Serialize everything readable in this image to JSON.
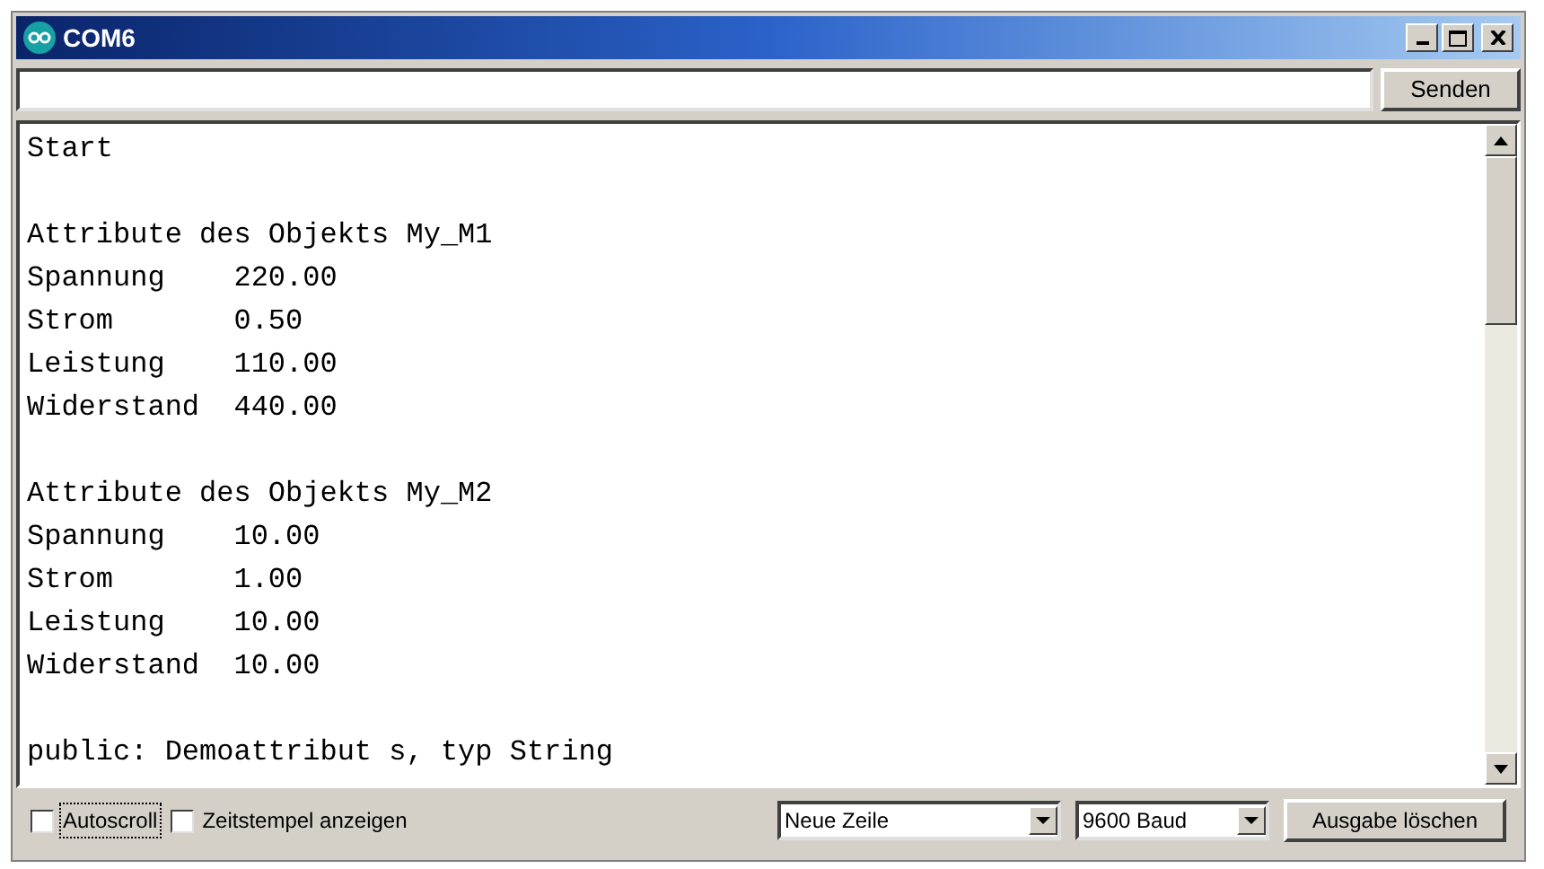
{
  "window": {
    "title": "COM6"
  },
  "send": {
    "button": "Senden"
  },
  "output": [
    {
      "lines": [
        "Start"
      ]
    },
    {
      "lines": [
        "Attribute des Objekts My_M1",
        "Spannung    220.00",
        "Strom       0.50",
        "Leistung    110.00",
        "Widerstand  440.00"
      ]
    },
    {
      "lines": [
        "Attribute des Objekts My_M2",
        "Spannung    10.00",
        "Strom       1.00",
        "Leistung    10.00",
        "Widerstand  10.00"
      ]
    },
    {
      "lines": [
        "public: Demoattribut s, typ String"
      ]
    }
  ],
  "options": [
    {
      "label": "Autoscroll",
      "checked": false,
      "focused": true
    },
    {
      "label": "Zeitstempel anzeigen",
      "checked": false,
      "focused": false
    }
  ],
  "line_ending": "Neue Zeile",
  "baud": "9600 Baud",
  "clear_button": "Ausgabe löschen"
}
